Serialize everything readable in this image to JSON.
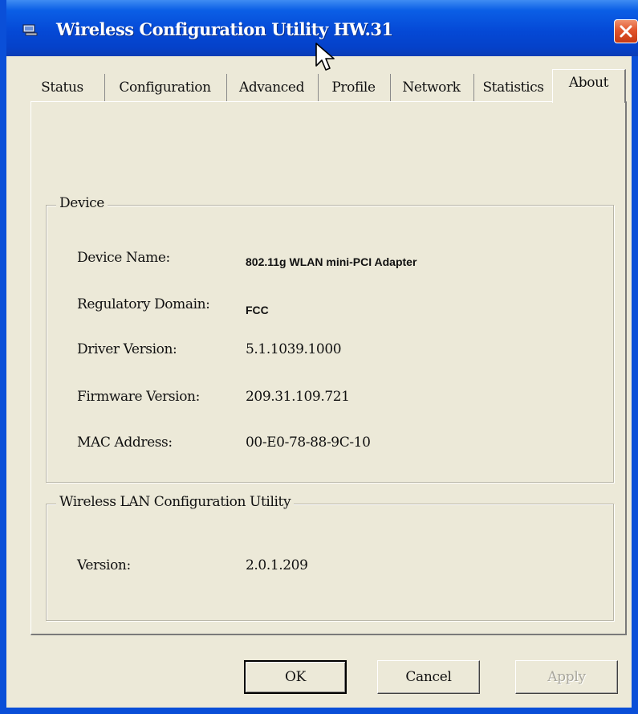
{
  "window": {
    "title": "Wireless Configuration Utility HW.31",
    "accent_color": "#0549d6",
    "close_icon": "close-icon"
  },
  "tabs": [
    {
      "label": "Status",
      "active": false
    },
    {
      "label": "Configuration",
      "active": false
    },
    {
      "label": "Advanced",
      "active": false
    },
    {
      "label": "Profile",
      "active": false
    },
    {
      "label": "Network",
      "active": false
    },
    {
      "label": "Statistics",
      "active": false
    },
    {
      "label": "About",
      "active": true
    }
  ],
  "device": {
    "legend": "Device",
    "fields": [
      {
        "label": "Device Name:",
        "value": "802.11g WLAN mini-PCI Adapter"
      },
      {
        "label": "Regulatory Domain:",
        "value": "FCC"
      },
      {
        "label": "Driver Version:",
        "value": "5.1.1039.1000"
      },
      {
        "label": "Firmware Version:",
        "value": "209.31.109.721"
      },
      {
        "label": "MAC Address:",
        "value": "00-E0-78-88-9C-10"
      }
    ]
  },
  "utility": {
    "legend": "Wireless LAN Configuration Utility",
    "fields": [
      {
        "label": "Version:",
        "value": "2.0.1.209"
      }
    ]
  },
  "buttons": {
    "ok": "OK",
    "cancel": "Cancel",
    "apply": "Apply"
  }
}
